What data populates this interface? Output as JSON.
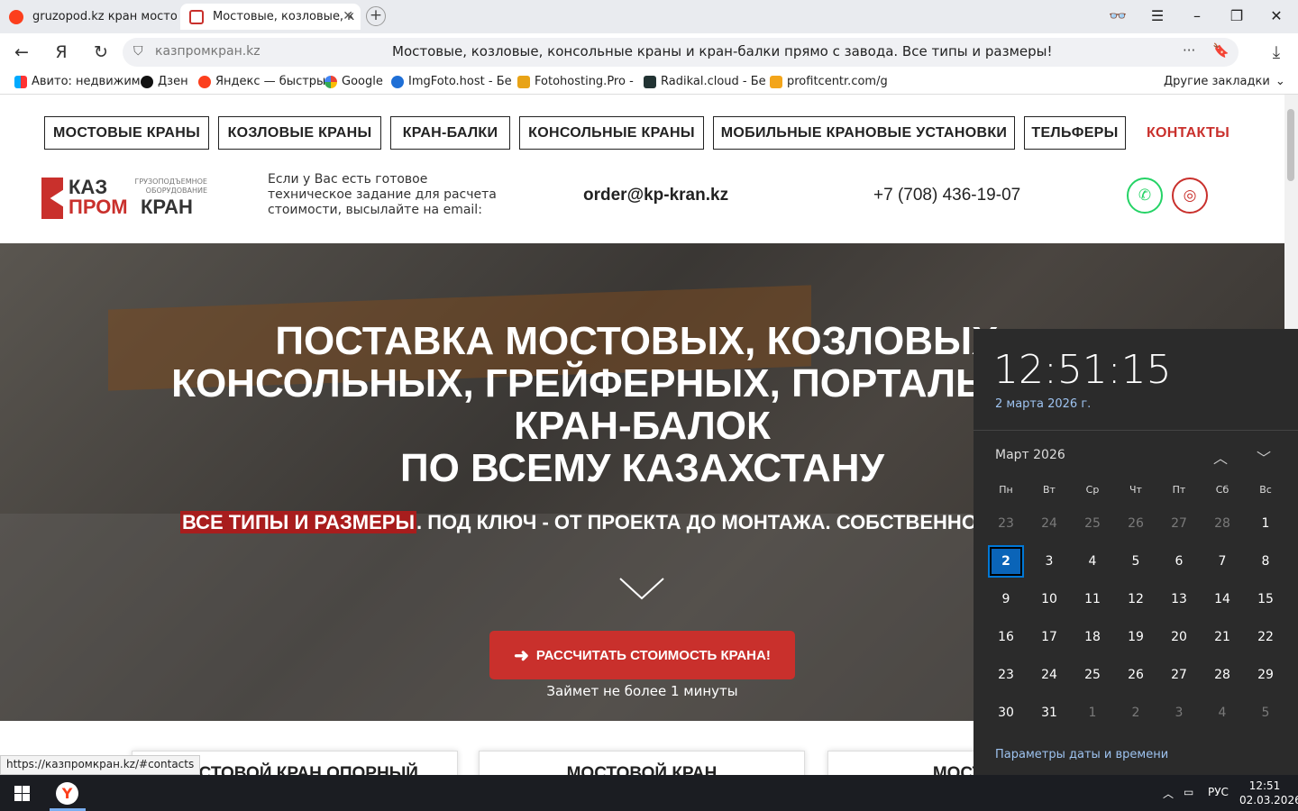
{
  "browser": {
    "tabs": [
      {
        "title": "gruzopod.kz кран мостово"
      },
      {
        "title": "Мостовые, козловые, к"
      }
    ],
    "url": "казпромкран.kz",
    "page_title": "Мостовые, козловые, консольные краны и кран-балки прямо с завода. Все типы и размеры!",
    "bookmarks": [
      "Авито: недвижим",
      "Дзен",
      "Яндекс — быстры",
      "Google",
      "ImgFoto.host - Бе",
      "Fotohosting.Pro - ",
      "Radikal.cloud - Бе",
      "profitcentr.com/g"
    ],
    "other_bookmarks": "Другие закладки",
    "status_url": "https://казпромкран.kz/#contacts"
  },
  "site": {
    "menu": [
      "МОСТОВЫЕ КРАНЫ",
      "КОЗЛОВЫЕ КРАНЫ",
      "КРАН-БАЛКИ",
      "КОНСОЛЬНЫЕ КРАНЫ",
      "МОБИЛЬНЫЕ КРАНОВЫЕ УСТАНОВКИ",
      "ТЕЛЬФЕРЫ",
      "КОНТАКТЫ"
    ],
    "logo": {
      "line1": "КАЗ",
      "line2a": "ПРОМ",
      "line2b": "КРАН",
      "tagline": "ГРУЗОПОДЪЕМНОЕ ОБОРУДОВАНИЕ"
    },
    "info_text": "Если у Вас есть готовое техническое задание для расчета стоимости, высылайте на email:",
    "email": "order@kp-kran.kz",
    "phone": "+7 (708) 436-19-07",
    "hero": {
      "title_lines": [
        "ПОСТАВКА МОСТОВЫХ, КОЗЛОВЫХ,",
        "КОНСОЛЬНЫХ, ГРЕЙФЕРНЫХ, ПОРТАЛЬНЫХ К",
        "КРАН-БАЛОК",
        "ПО ВСЕМУ КАЗАХСТАНУ"
      ],
      "sub_highlight": "ВСЕ ТИПЫ И РАЗМЕРЫ",
      "sub_rest": ". ПОД КЛЮЧ - ОТ ПРОЕКТА ДО МОНТАЖА. СОБСТВЕННОЕ ПР",
      "cta": "РАССЧИТАТЬ СТОИМОСТЬ КРАНА!",
      "note": "Займет не более 1 минуты"
    },
    "cards": [
      "МОСТОВОЙ КРАН ОПОРНЫЙ",
      "МОСТОВОЙ КРАН",
      "МОСТОВОЙ К"
    ]
  },
  "calendar": {
    "time": "12:51:15",
    "date": "2 марта 2026 г.",
    "month": "Март 2026",
    "weekdays": [
      "Пн",
      "Вт",
      "Ср",
      "Чт",
      "Пт",
      "Сб",
      "Вс"
    ],
    "days": [
      [
        "23",
        "24",
        "25",
        "26",
        "27",
        "28",
        "1"
      ],
      [
        "2",
        "3",
        "4",
        "5",
        "6",
        "7",
        "8"
      ],
      [
        "9",
        "10",
        "11",
        "12",
        "13",
        "14",
        "15"
      ],
      [
        "16",
        "17",
        "18",
        "19",
        "20",
        "21",
        "22"
      ],
      [
        "23",
        "24",
        "25",
        "26",
        "27",
        "28",
        "29"
      ],
      [
        "30",
        "31",
        "1",
        "2",
        "3",
        "4",
        "5"
      ]
    ],
    "selected": "2",
    "settings_link": "Параметры даты и времени"
  },
  "taskbar": {
    "lang": "РУС",
    "time": "12:51",
    "date": "02.03.2026"
  },
  "colors": {
    "brand_red": "#c9302c",
    "whatsapp": "#25d366",
    "instagram": "#c9302c",
    "calendar_bg": "#2b2b2b",
    "accent_blue": "#0078d7"
  }
}
